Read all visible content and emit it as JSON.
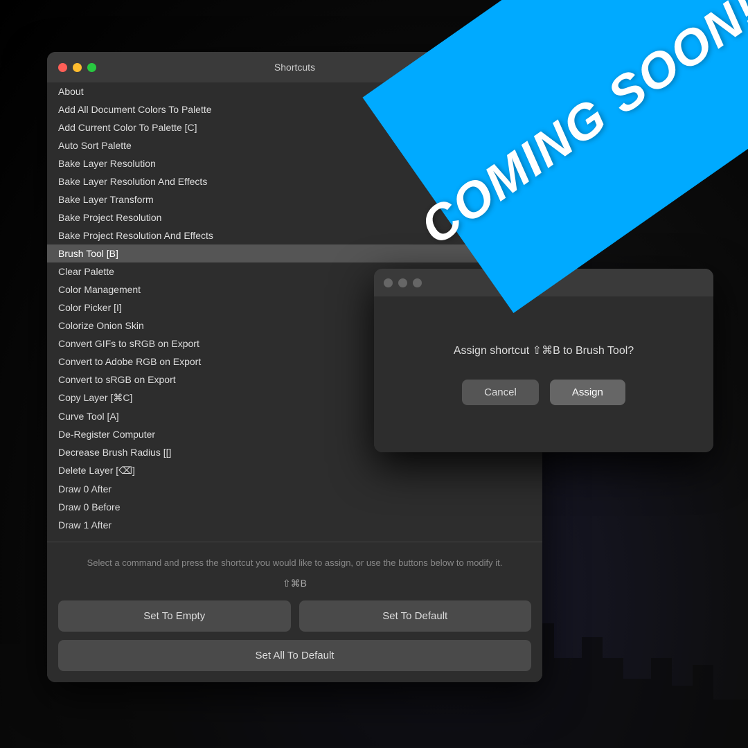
{
  "background": {
    "color": "#000000"
  },
  "main_window": {
    "title": "Shortcuts",
    "dots": [
      "red",
      "yellow",
      "green"
    ],
    "commands": [
      {
        "label": "About",
        "selected": false
      },
      {
        "label": "Add All Document Colors To Palette",
        "selected": false
      },
      {
        "label": "Add Current Color To Palette [C]",
        "selected": false
      },
      {
        "label": "Auto Sort Palette",
        "selected": false
      },
      {
        "label": "Bake Layer Resolution",
        "selected": false
      },
      {
        "label": "Bake Layer Resolution And Effects",
        "selected": false
      },
      {
        "label": "Bake Layer Transform",
        "selected": false
      },
      {
        "label": "Bake Project Resolution",
        "selected": false
      },
      {
        "label": "Bake Project Resolution And Effects",
        "selected": false
      },
      {
        "label": "Brush Tool [B]",
        "selected": true
      },
      {
        "label": "Clear Palette",
        "selected": false
      },
      {
        "label": "Color Management",
        "selected": false
      },
      {
        "label": "Color Picker [I]",
        "selected": false
      },
      {
        "label": "Colorize Onion Skin",
        "selected": false
      },
      {
        "label": "Convert GIFs to sRGB on Export",
        "selected": false
      },
      {
        "label": "Convert to Adobe RGB on Export",
        "selected": false
      },
      {
        "label": "Convert to sRGB on Export",
        "selected": false
      },
      {
        "label": "Copy Layer [⌘C]",
        "selected": false
      },
      {
        "label": "Curve Tool [A]",
        "selected": false
      },
      {
        "label": "De-Register Computer",
        "selected": false
      },
      {
        "label": "Decrease Brush Radius [[]",
        "selected": false
      },
      {
        "label": "Delete Layer [⌫]",
        "selected": false
      },
      {
        "label": "Draw 0 After",
        "selected": false
      },
      {
        "label": "Draw 0 Before",
        "selected": false
      },
      {
        "label": "Draw 1 After",
        "selected": false
      }
    ],
    "instructions": "Select a command and press the shortcut you would like to assign,\nor use the buttons below to modify it.",
    "shortcut_display": "⇧⌘B",
    "buttons": {
      "set_to_empty": "Set To Empty",
      "set_to_default": "Set To Default",
      "set_all_to_default": "Set All To Default"
    }
  },
  "dialog": {
    "message": "Assign shortcut ⇧⌘B to Brush Tool?",
    "cancel_label": "Cancel",
    "assign_label": "Assign"
  },
  "banner": {
    "text": "COMING SOON!",
    "color": "#00aaff"
  }
}
